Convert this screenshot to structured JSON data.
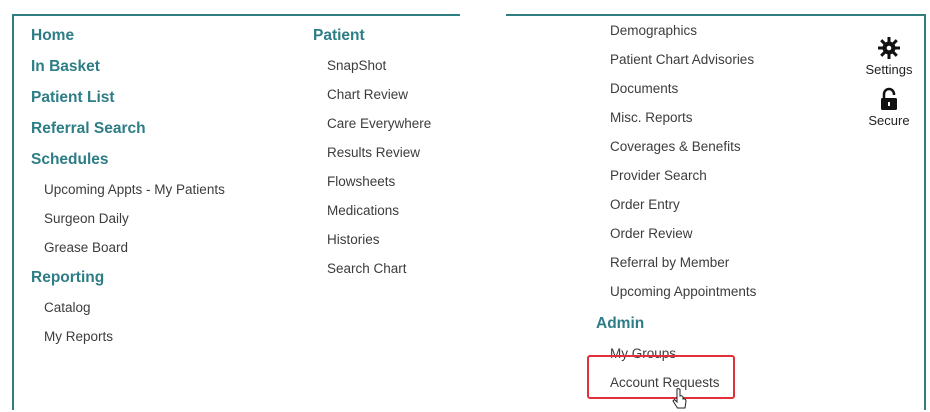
{
  "col1": {
    "home": "Home",
    "in_basket": "In Basket",
    "patient_list": "Patient List",
    "referral_search": "Referral Search",
    "schedules": "Schedules",
    "schedules_items": [
      "Upcoming Appts - My Patients",
      "Surgeon Daily",
      "Grease Board"
    ],
    "reporting": "Reporting",
    "reporting_items": [
      "Catalog",
      "My Reports"
    ]
  },
  "col2": {
    "patient": "Patient",
    "items": [
      "SnapShot",
      "Chart Review",
      "Care Everywhere",
      "Results Review",
      "Flowsheets",
      "Medications",
      "Histories",
      "Search Chart"
    ]
  },
  "col3": {
    "items": [
      "Demographics",
      "Patient Chart Advisories",
      "Documents",
      "Misc. Reports",
      "Coverages & Benefits",
      "Provider Search",
      "Order Entry",
      "Order Review",
      "Referral by Member",
      "Upcoming Appointments"
    ],
    "admin": "Admin",
    "admin_items": [
      "My Groups",
      "Account Requests"
    ]
  },
  "tools": {
    "settings": "Settings",
    "secure": "Secure",
    "settings_icon": "gear-icon",
    "secure_icon": "lock-icon"
  },
  "colors": {
    "heading": "#2d7d86",
    "border": "#2f7f80",
    "highlight": "#e0303a"
  }
}
